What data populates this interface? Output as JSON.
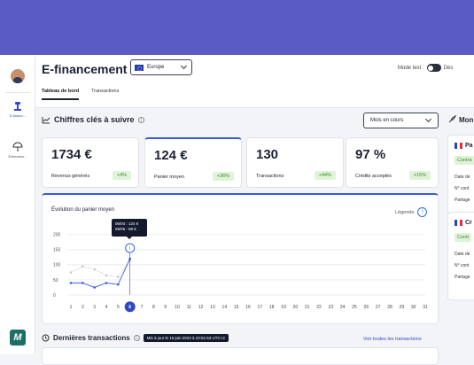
{
  "app": {
    "title": "E-financement",
    "region": "Europe",
    "test_mode_label": "Mode test :",
    "test_mode_state": "Dés"
  },
  "sidebar": {
    "items": [
      {
        "label": "E-financ...",
        "icon": "gavel-icon",
        "active": true
      },
      {
        "label": "Extension...",
        "icon": "umbrella-icon",
        "active": false
      }
    ],
    "logo_text": "M"
  },
  "tabs": [
    {
      "label": "Tableau de bord",
      "active": true
    },
    {
      "label": "Transactions",
      "active": false
    }
  ],
  "key_figures": {
    "title": "Chiffres clés à suivre",
    "period": "Mois en cours",
    "cards": [
      {
        "value": "1734 €",
        "label": "Revenus générés",
        "change": "+4%"
      },
      {
        "value": "124 €",
        "label": "Panier moyen",
        "change": "+36%"
      },
      {
        "value": "130",
        "label": "Transactions",
        "change": "+44%"
      },
      {
        "value": "97 %",
        "label": "Crédits acceptés",
        "change": "+15%"
      }
    ]
  },
  "chart_panel": {
    "title": "Évolution du panier moyen",
    "legend_label": "Légende",
    "tooltip_line1": "06/04 : 124 €",
    "tooltip_line2": "06/05 : 88 €"
  },
  "chart_data": {
    "type": "line",
    "x": [
      1,
      2,
      3,
      4,
      5,
      6,
      7,
      8,
      9,
      10,
      11,
      12,
      13,
      14,
      15,
      16,
      17,
      18,
      19,
      20,
      21,
      22,
      23,
      24,
      25,
      26,
      27,
      28,
      29,
      30,
      31
    ],
    "selected_x": 6,
    "yticks": [
      0,
      50,
      100,
      150,
      200
    ],
    "ylim": [
      0,
      220
    ],
    "series": [
      {
        "values": [
          40,
          40,
          25,
          40,
          35,
          120
        ],
        "color": "#3b5bd9"
      },
      {
        "values": [
          75,
          95,
          85,
          65,
          60,
          115
        ],
        "color": "#c3c8d6",
        "dashed": true
      }
    ],
    "grid": true
  },
  "transactions": {
    "title": "Dernières transactions",
    "updated": "Mis à jour le 16 juin 2023 à 10:51:53 UTC+2",
    "see_all": "Voir toutes les transactions"
  },
  "right_panel": {
    "title": "Mon",
    "cards": [
      {
        "title": "Pa",
        "badge": "Contra",
        "lines": [
          "Date de",
          "N° cont",
          "Partage"
        ]
      },
      {
        "title": "Cr",
        "badge": "Contr",
        "lines": [
          "Date de",
          "N° cont",
          "Partage"
        ]
      }
    ]
  }
}
